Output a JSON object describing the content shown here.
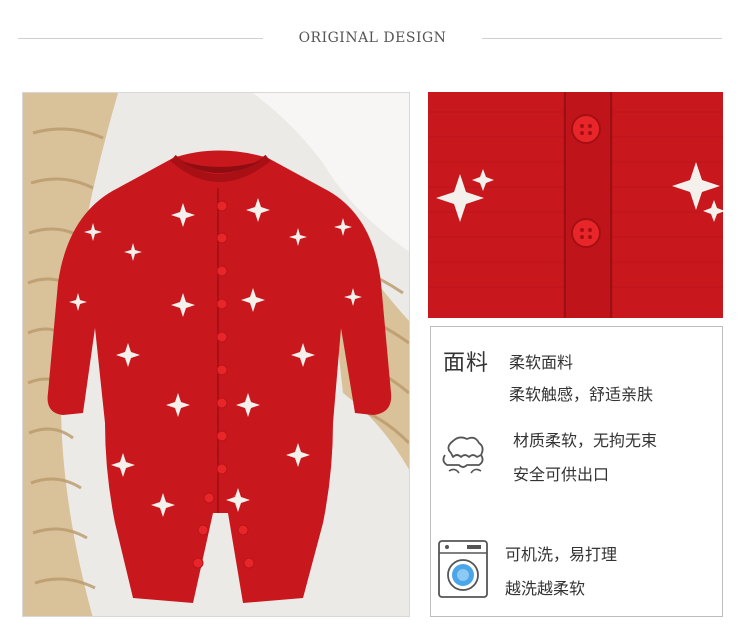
{
  "header": {
    "title": "ORIGINAL DESIGN"
  },
  "colors": {
    "garment_red": "#c8171d",
    "button_red": "#e8262a",
    "star_white": "#f4f1ec"
  },
  "features": [
    {
      "icon": "fabric-text-icon",
      "icon_text": "面料",
      "lines": [
        "柔软面料",
        "柔软触感，舒适亲肤"
      ]
    },
    {
      "icon": "cloud-icon",
      "lines": [
        "材质柔软，无拘无束",
        "安全可供出口"
      ]
    },
    {
      "icon": "washing-machine-icon",
      "lines": [
        "可机洗，易打理",
        "越洗越柔软"
      ]
    }
  ]
}
